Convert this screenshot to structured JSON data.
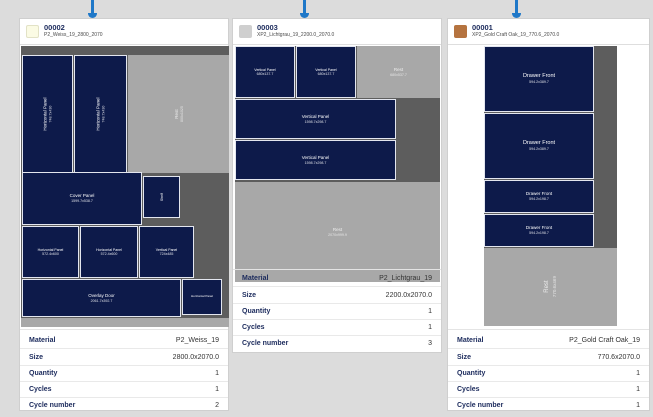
{
  "colors": {
    "piece": "#0d1a4a",
    "rest": "#a8a8a8",
    "waste": "#5d5d5d",
    "connector": "#1f78c8"
  },
  "info_labels": {
    "material": "Material",
    "size": "Size",
    "quantity": "Quantity",
    "cycles": "Cycles",
    "cycle_number": "Cycle number"
  },
  "cards": [
    {
      "id": "00002",
      "subtitle": "P2_Weiss_19_2800_2070",
      "swatch_color": "#fbfbe4",
      "pieces": [
        {
          "label": "Horizontal Panel",
          "dim": "748.7x430"
        },
        {
          "label": "Horizontal Panel",
          "dim": "748.7x430"
        },
        {
          "label": "Rest",
          "dim": "800x1025"
        },
        {
          "label": "Cover Panel",
          "dim": "1599.7x538.7"
        },
        {
          "label": "Shelf",
          "dim": ""
        },
        {
          "label": "Horizontal Panel",
          "dim": "572.4x600"
        },
        {
          "label": "Horizontal Panel",
          "dim": "572.4x600"
        },
        {
          "label": "Vertical Panel",
          "dim": "724x485"
        },
        {
          "label": "Overlay Door",
          "dim": "2061.7x392.7"
        },
        {
          "label": "Horizontal Panel",
          "dim": ""
        }
      ],
      "info": {
        "material": "P2_Weiss_19",
        "size": "2800.0x2070.0",
        "quantity": "1",
        "cycles": "1",
        "cycle_number": "2"
      }
    },
    {
      "id": "00003",
      "subtitle": "XP2_Lichtgrau_19_2200.0_2070.0",
      "swatch_color": "#cfcfcf",
      "pieces": [
        {
          "label": "Vertical Panel",
          "dim": "680x137.7"
        },
        {
          "label": "Vertical Panel",
          "dim": "680x137.7"
        },
        {
          "label": "Rest",
          "dim": "680x537.7"
        },
        {
          "label": "Vertical Panel",
          "dim": "1598.7x298.7"
        },
        {
          "label": "Vertical Panel",
          "dim": "1598.7x298.7"
        },
        {
          "label": "Rest",
          "dim": "2070x999.9"
        }
      ],
      "info": {
        "material": "P2_Lichtgrau_19",
        "size": "2200.0x2070.0",
        "quantity": "1",
        "cycles": "1",
        "cycle_number": "3"
      }
    },
    {
      "id": "00001",
      "subtitle": "XP2_Gold Craft Oak_19_770.6_2070.0",
      "swatch_color": "#b5733f",
      "pieces": [
        {
          "label": "Drawer Front",
          "dim": "594.2x389.7"
        },
        {
          "label": "Drawer Front",
          "dim": "594.2x389.7"
        },
        {
          "label": "Drawer Front",
          "dim": "594.2x198.7"
        },
        {
          "label": "Drawer Front",
          "dim": "594.2x198.7"
        },
        {
          "label": "Rest",
          "dim": "770.6x469"
        }
      ],
      "info": {
        "material": "P2_Gold Craft Oak_19",
        "size": "770.6x2070.0",
        "quantity": "1",
        "cycles": "1",
        "cycle_number": "1"
      }
    }
  ]
}
